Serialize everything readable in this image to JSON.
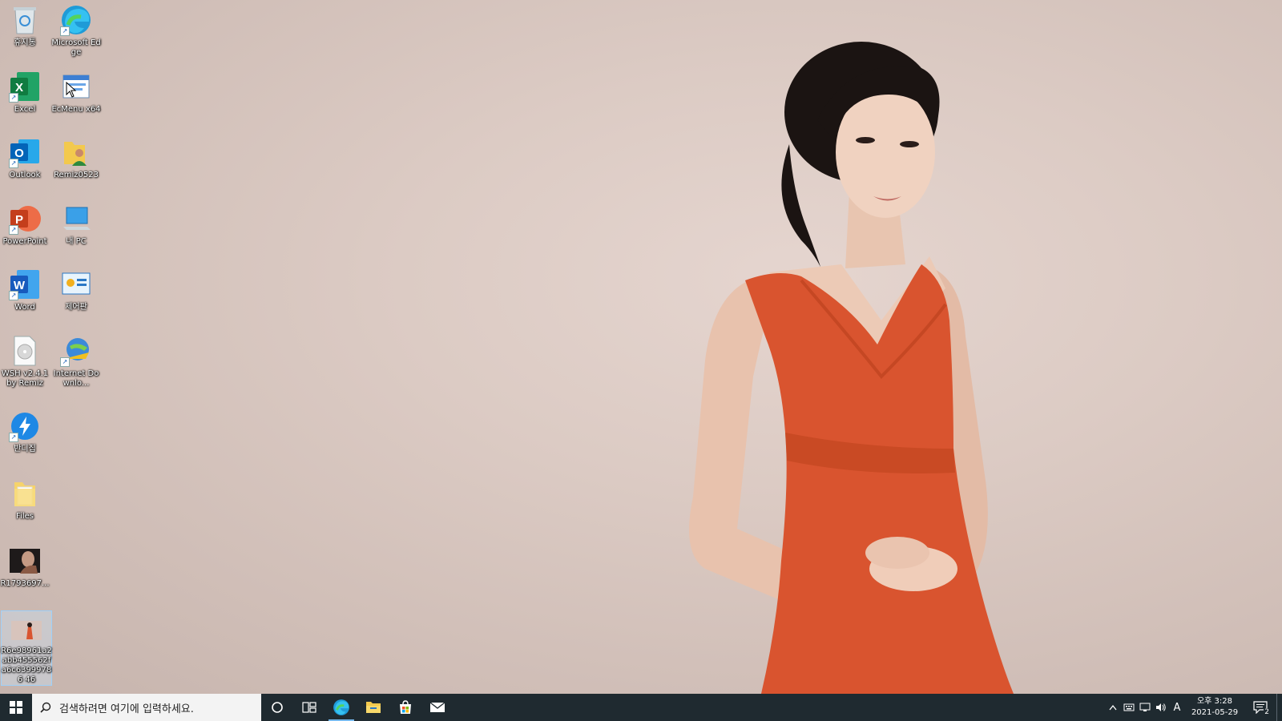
{
  "desktop": {
    "icons": [
      {
        "label": "휴지통"
      },
      {
        "label": "Microsoft Edge"
      },
      {
        "label": "Excel"
      },
      {
        "label": "EcMenu x64"
      },
      {
        "label": "Outlook"
      },
      {
        "label": "Remiz0523"
      },
      {
        "label": "PowerPoint"
      },
      {
        "label": "내 PC"
      },
      {
        "label": "Word"
      },
      {
        "label": "제어판"
      },
      {
        "label": "WSH v2.4.1 by Remiz"
      },
      {
        "label": "Internet Downlo..."
      },
      {
        "label": "반디집"
      },
      {
        "label": "Files"
      },
      {
        "label": "R1793697..."
      },
      {
        "label": "R6e98961a2abb455562fa6c63999786 46"
      }
    ]
  },
  "taskbar": {
    "search_placeholder": "검색하려면 여기에 입력하세요.",
    "apps": [
      {
        "name": "Cortana"
      },
      {
        "name": "Task View"
      },
      {
        "name": "Microsoft Edge"
      },
      {
        "name": "File Explorer"
      },
      {
        "name": "Microsoft Store"
      },
      {
        "name": "Mail"
      }
    ],
    "tray": {
      "ime_mode": "A",
      "time": "오후 3:28",
      "date": "2021-05-29",
      "notification_count": "2"
    }
  },
  "colors": {
    "taskbar_bg": "#1f2a30",
    "dress": "#d9542f",
    "wallpaper": "#dccbc4"
  }
}
